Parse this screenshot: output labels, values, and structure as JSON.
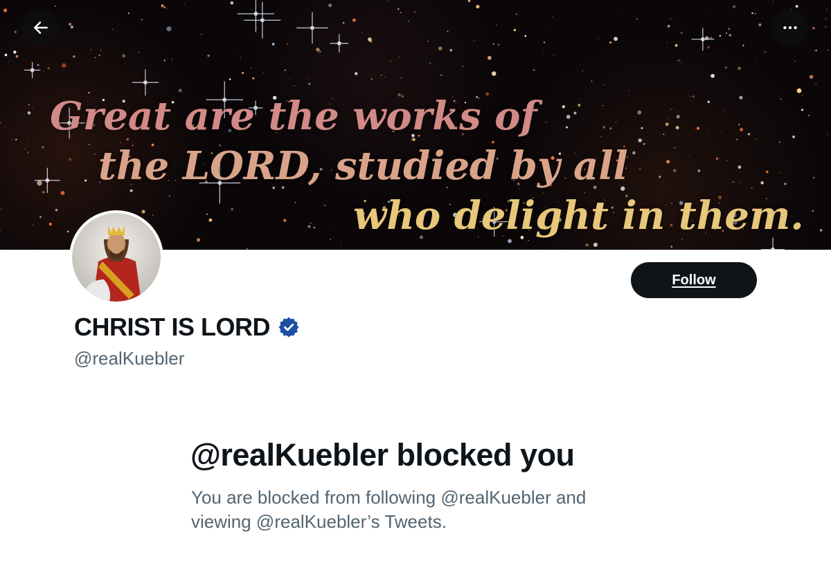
{
  "banner": {
    "verse_lines": [
      "Great are the works of",
      "the LORD, studied by all",
      "who delight in them."
    ],
    "verse_colors": [
      "#d18a86",
      "#d9a38a",
      "#e7c77a"
    ]
  },
  "nav": {
    "back_icon": "arrow-left-icon",
    "more_icon": "more-horizontal-icon"
  },
  "profile": {
    "display_name": "CHRIST IS LORD",
    "verified": true,
    "verified_color": "#1d4fa3",
    "handle": "@realKuebler",
    "follow_label": "Follow"
  },
  "blocked": {
    "title": "@realKuebler blocked you",
    "description": "You are blocked from following @realKuebler and viewing @realKuebler’s Tweets."
  }
}
